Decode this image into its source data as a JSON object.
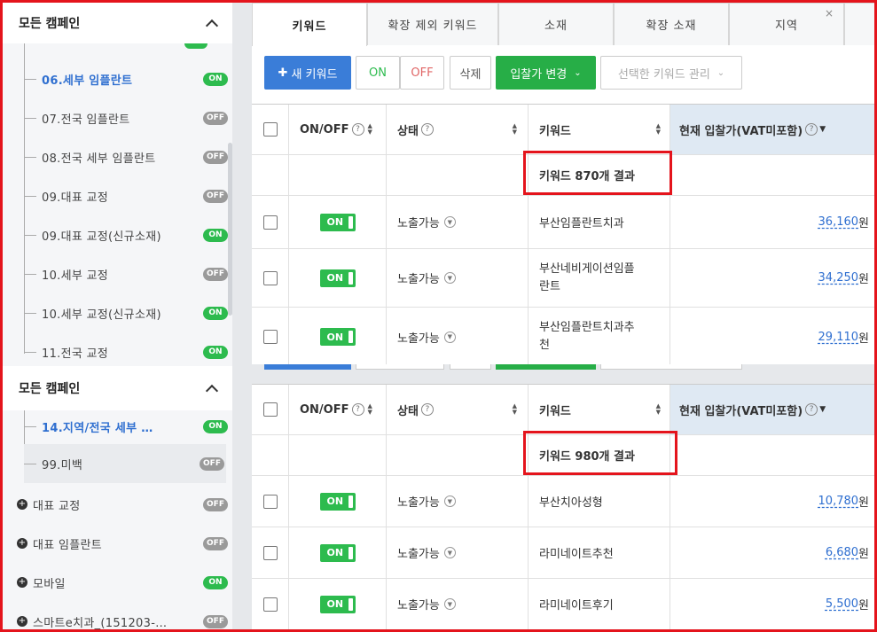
{
  "sidebar": {
    "header1": "모든 캠페인",
    "header2": "모든 캠페인",
    "items1": [
      {
        "label": "06.세부 임플란트",
        "status": "ON",
        "active": true
      },
      {
        "label": "07.전국 임플란트",
        "status": "OFF"
      },
      {
        "label": "08.전국 세부 임플란트",
        "status": "OFF"
      },
      {
        "label": "09.대표 교정",
        "status": "OFF"
      },
      {
        "label": "09.대표 교정(신규소재)",
        "status": "ON"
      },
      {
        "label": "10.세부 교정",
        "status": "OFF"
      },
      {
        "label": "10.세부 교정(신규소재)",
        "status": "ON"
      },
      {
        "label": "11.전국 교정",
        "status": "ON"
      }
    ],
    "items2": [
      {
        "label": "14.지역/전국 세부 …",
        "status": "ON",
        "active": true
      },
      {
        "label": "99.미백",
        "status": "OFF"
      }
    ],
    "groups": [
      {
        "label": "대표 교정",
        "status": "OFF"
      },
      {
        "label": "대표 임플란트",
        "status": "OFF"
      },
      {
        "label": "모바일",
        "status": "ON"
      },
      {
        "label": "스마트e치과_(151203-…",
        "status": "OFF"
      }
    ]
  },
  "tabs": [
    "키워드",
    "확장 제외 키워드",
    "소재",
    "확장 소재",
    "지역"
  ],
  "toolbar": {
    "new_keyword": "새 키워드",
    "on": "ON",
    "off": "OFF",
    "delete": "삭제",
    "bid_change": "입찰가 변경",
    "manage": "선택한 키워드 관리"
  },
  "table_headers": {
    "onoff": "ON/OFF",
    "status": "상태",
    "keyword": "키워드",
    "bid": "현재 입찰가(VAT미포함)"
  },
  "table1": {
    "result": "키워드 870개 결과",
    "rows": [
      {
        "toggle": "ON",
        "status": "노출가능",
        "keyword": "부산임플란트치과",
        "bid": "36,160",
        "unit": "원"
      },
      {
        "toggle": "ON",
        "status": "노출가능",
        "keyword_l1": "부산네비게이션임플",
        "keyword_l2": "란트",
        "bid": "34,250",
        "unit": "원"
      },
      {
        "toggle": "ON",
        "status": "노출가능",
        "keyword_l1": "부산임플란트치과추",
        "keyword_l2": "천",
        "bid": "29,110",
        "unit": "원"
      }
    ]
  },
  "table2": {
    "result": "키워드 980개 결과",
    "rows": [
      {
        "toggle": "ON",
        "status": "노출가능",
        "keyword": "부산치아성형",
        "bid": "10,780",
        "unit": "원"
      },
      {
        "toggle": "ON",
        "status": "노출가능",
        "keyword": "라미네이트추천",
        "bid": "6,680",
        "unit": "원"
      },
      {
        "toggle": "ON",
        "status": "노출가능",
        "keyword": "라미네이트후기",
        "bid": "5,500",
        "unit": "원"
      }
    ]
  }
}
